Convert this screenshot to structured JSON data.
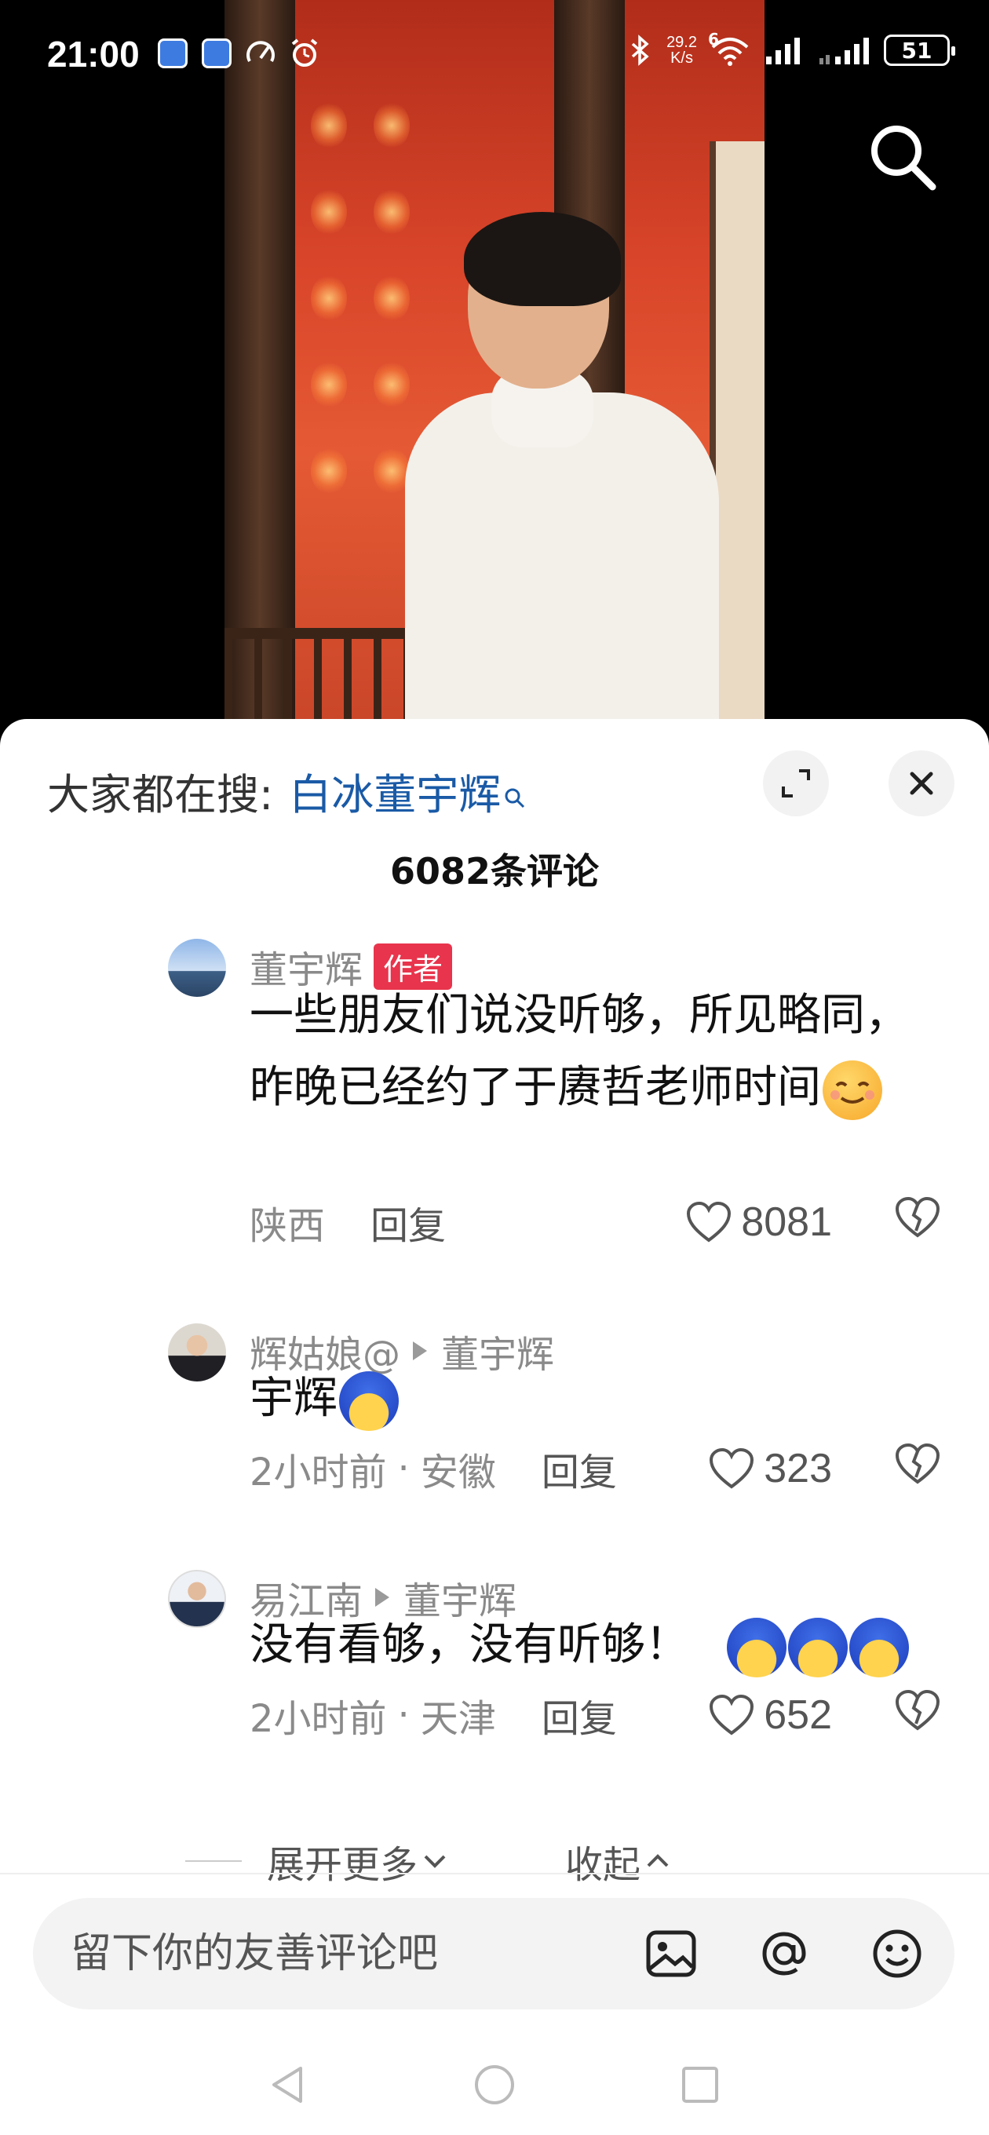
{
  "status_bar": {
    "time": "21:00",
    "net_speed_value": "29.2",
    "net_speed_unit": "K/s",
    "network_type": "6",
    "battery": "51"
  },
  "search_trending": {
    "prefix": "大家都在搜:",
    "keyword": "白冰董宇辉"
  },
  "comments_header": {
    "count_label": "6082条评论"
  },
  "comments": [
    {
      "username": "董宇辉",
      "author_tag": "作者",
      "text": "一些朋友们说没听够，所见略同，昨晚已经约了于赓哲老师时间",
      "emoji": "smile-emoji",
      "location": "陕西",
      "reply_label": "回复",
      "likes": "8081"
    },
    {
      "username": "辉姑娘@",
      "reply_to": "董宇辉",
      "text": "宇辉",
      "emoji": "blue-hair-emoji",
      "time": "2小时前",
      "location": "安徽",
      "reply_label": "回复",
      "likes": "323"
    },
    {
      "username": "易江南",
      "reply_to": "董宇辉",
      "text": "没有看够，没有听够！",
      "emoji": "blue-hair-emoji",
      "time": "2小时前",
      "location": "天津",
      "reply_label": "回复",
      "likes": "652"
    }
  ],
  "expand": {
    "more_label": "展开更多",
    "collapse_label": "收起"
  },
  "input": {
    "placeholder": "留下你的友善评论吧"
  },
  "icons": {
    "search": "search-icon",
    "expand": "fullscreen-icon",
    "close": "close-icon",
    "like": "heart-icon",
    "dislike": "broken-heart-icon",
    "image": "image-icon",
    "mention": "at-icon",
    "emoji": "emoji-icon"
  },
  "colors": {
    "keyword": "#1a5aa6",
    "author_tag": "#e8344c",
    "meta_text": "#8a8a8a"
  }
}
